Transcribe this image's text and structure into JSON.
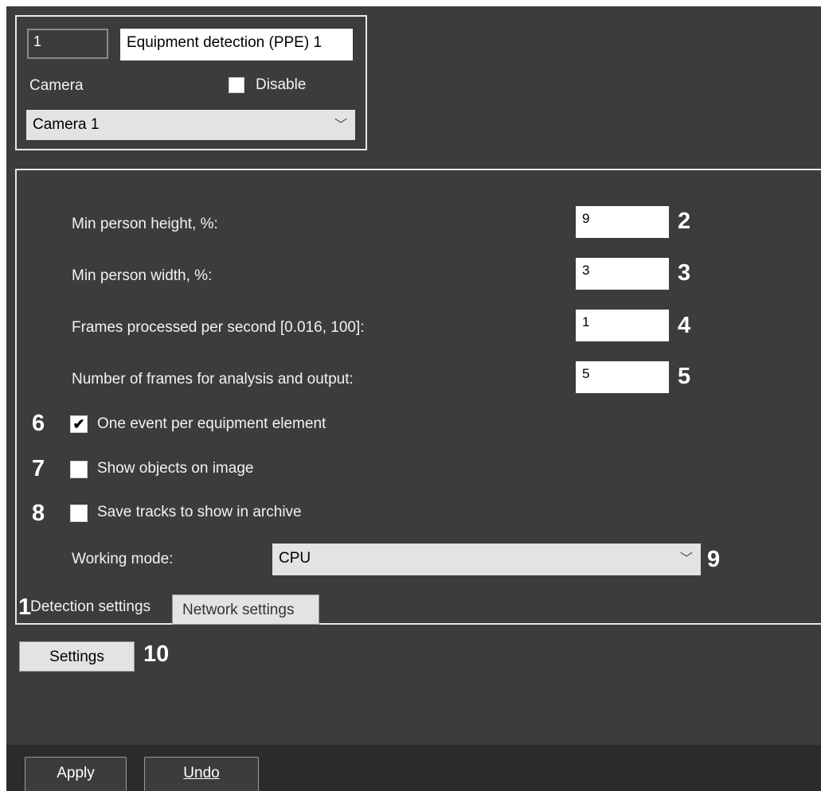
{
  "header": {
    "id_value": "1",
    "name_value": "Equipment detection (PPE) 1",
    "camera_label": "Camera",
    "disable_label": "Disable",
    "camera_selected": "Camera 1"
  },
  "detection": {
    "min_height_label": "Min person height, %:",
    "min_height_value": "9",
    "min_width_label": "Min person width, %:",
    "min_width_value": "3",
    "fps_label": "Frames processed per second [0.016, 100]:",
    "fps_value": "1",
    "frames_label": "Number of frames for analysis and output:",
    "frames_value": "5",
    "one_event_label": "One event per equipment element",
    "one_event_checked": true,
    "show_objects_label": "Show objects on image",
    "show_objects_checked": false,
    "save_tracks_label": "Save tracks to show in archive",
    "save_tracks_checked": false,
    "working_mode_label": "Working mode:",
    "working_mode_value": "CPU"
  },
  "tabs": {
    "detection": "Detection settings",
    "network": "Network settings"
  },
  "buttons": {
    "settings": "Settings",
    "apply": "Apply",
    "undo": "Undo"
  },
  "callouts": {
    "n1": "1",
    "n2": "2",
    "n3": "3",
    "n4": "4",
    "n5": "5",
    "n6": "6",
    "n7": "7",
    "n8": "8",
    "n9": "9",
    "n10": "10"
  },
  "icons": {
    "combo_arrow": "chevron-down-icon",
    "checkmark": "checkmark-icon"
  },
  "colors": {
    "panel_bg": "#3c3c3c",
    "footer_bg": "#2b2b2b",
    "field_bg": "#ffffff",
    "button_bg": "#e3e3e3"
  }
}
